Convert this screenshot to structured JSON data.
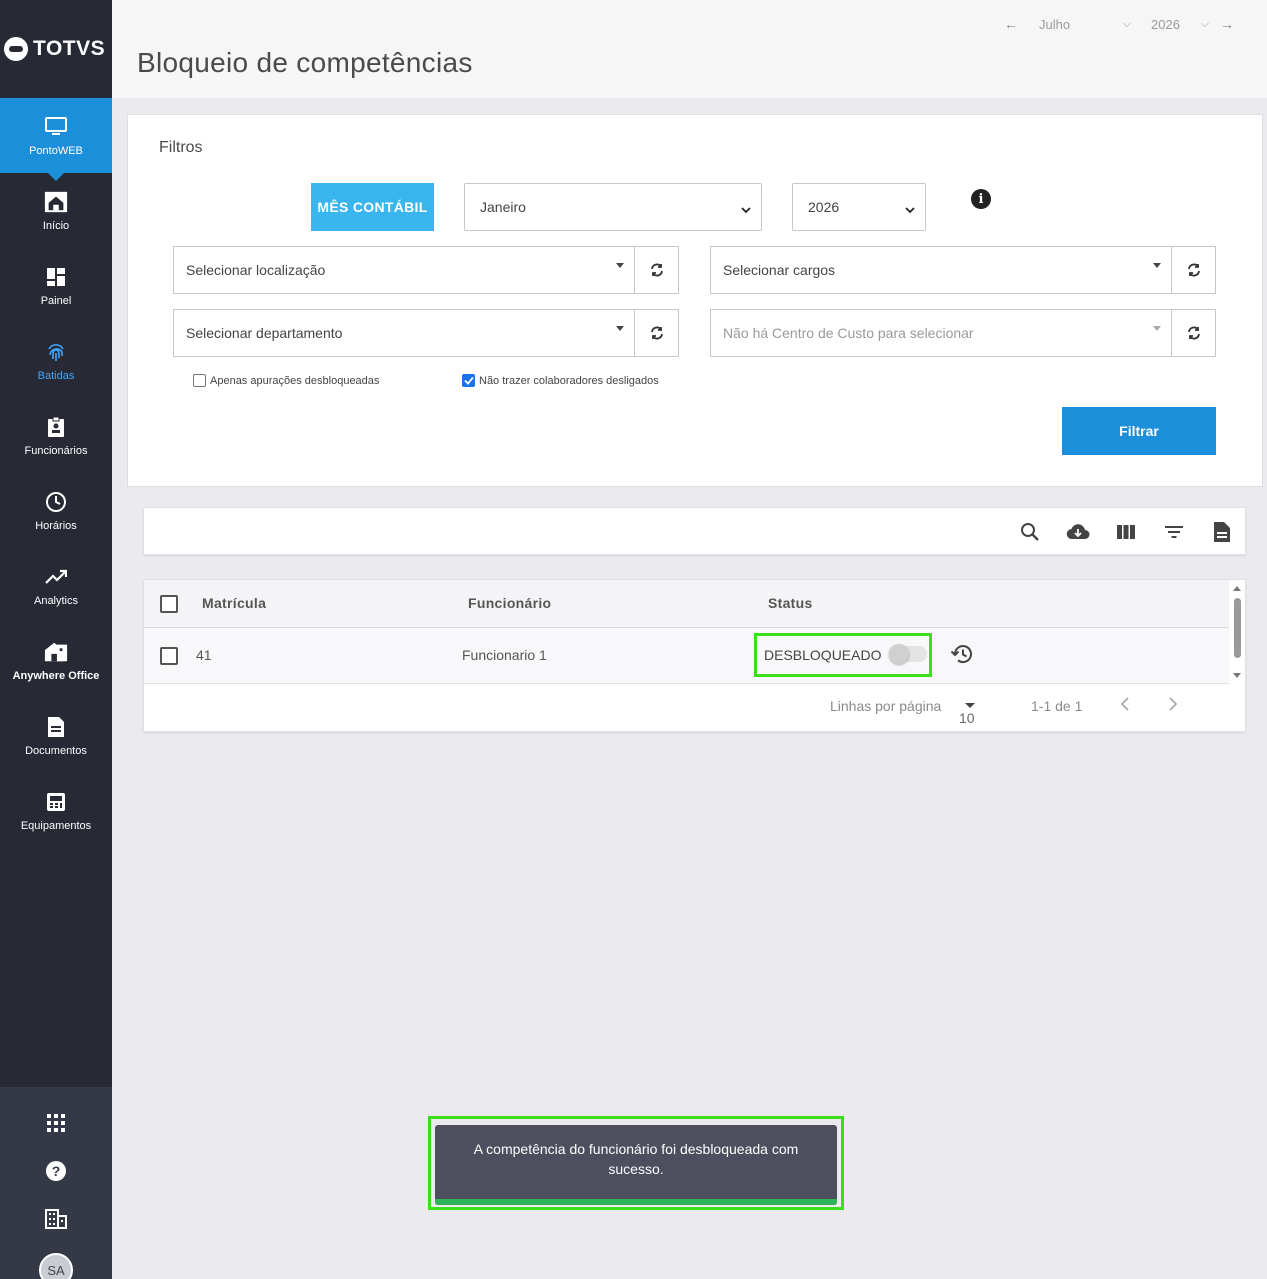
{
  "brand": {
    "name": "TOTVS"
  },
  "sidebar": {
    "items": [
      {
        "label": "PontoWEB",
        "icon": "monitor-icon"
      },
      {
        "label": "Início",
        "icon": "home-icon"
      },
      {
        "label": "Painel",
        "icon": "dashboard-icon"
      },
      {
        "label": "Batidas",
        "icon": "fingerprint-icon"
      },
      {
        "label": "Funcionários",
        "icon": "badge-icon"
      },
      {
        "label": "Horários",
        "icon": "clock-icon"
      },
      {
        "label": "Analytics",
        "icon": "trend-icon"
      },
      {
        "label": "Anywhere Office",
        "icon": "house-icon"
      },
      {
        "label": "Documentos",
        "icon": "document-icon"
      },
      {
        "label": "Equipamentos",
        "icon": "device-icon"
      }
    ],
    "avatar": "SA"
  },
  "header": {
    "title": "Bloqueio de competências",
    "month": "Julho",
    "year": "2026"
  },
  "filters": {
    "title": "Filtros",
    "mes_contabil_label": "MÊS CONTÁBIL",
    "month_value": "Janeiro",
    "year_value": "2026",
    "localizacao_placeholder": "Selecionar localização",
    "cargos_placeholder": "Selecionar cargos",
    "departamento_placeholder": "Selecionar departamento",
    "centro_custo_placeholder": "Não há Centro de Custo para selecionar",
    "apenas_desbloqueadas_label": "Apenas apurações desbloqueadas",
    "apenas_desbloqueadas_checked": false,
    "nao_trazer_desligados_label": "Não trazer colaboradores desligados",
    "nao_trazer_desligados_checked": true,
    "filtrar_label": "Filtrar"
  },
  "table": {
    "columns": [
      "Matrícula",
      "Funcionário",
      "Status"
    ],
    "rows": [
      {
        "matricula": "41",
        "funcionario": "Funcionario 1",
        "status": "DESBLOQUEADO",
        "toggle_on": false
      }
    ],
    "pagination": {
      "rows_per_page_label": "Linhas por página",
      "rows_per_page": "10",
      "range": "1-1 de 1"
    }
  },
  "toast": {
    "message": "A competência do funcionário foi desbloqueada com sucesso."
  },
  "colors": {
    "sidebar_bg": "#272a35",
    "accent": "#1b8fd9",
    "mes_button": "#3ab6ee",
    "highlight": "#3ae019",
    "toast_bg": "#4d4f5e",
    "toast_progress": "#2fb35a"
  }
}
